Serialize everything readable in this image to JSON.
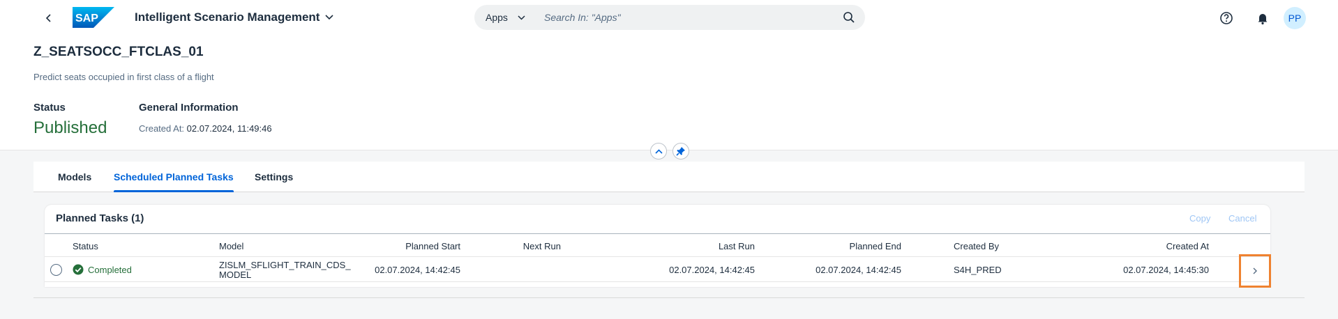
{
  "shell": {
    "logo_text": "SAP",
    "app_title": "Intelligent Scenario Management",
    "search_scope": "Apps",
    "search_placeholder": "Search In: \"Apps\"",
    "avatar_initials": "PP"
  },
  "header": {
    "title": "Z_SEATSOCC_FTCLAS_01",
    "subtitle": "Predict seats occupied in first class of a flight",
    "status_label": "Status",
    "status_value": "Published",
    "general_info_label": "General Information",
    "created_at_label": "Created At:",
    "created_at_value": "02.07.2024, 11:49:46"
  },
  "tabs": [
    {
      "label": "Models",
      "active": false
    },
    {
      "label": "Scheduled Planned Tasks",
      "active": true
    },
    {
      "label": "Settings",
      "active": false
    }
  ],
  "table": {
    "title": "Planned Tasks (1)",
    "actions": {
      "copy": "Copy",
      "cancel": "Cancel"
    },
    "columns": {
      "status": "Status",
      "model": "Model",
      "planned_start": "Planned Start",
      "next_run": "Next Run",
      "last_run": "Last Run",
      "planned_end": "Planned End",
      "created_by": "Created By",
      "created_at": "Created At"
    },
    "rows": [
      {
        "status": "Completed",
        "model_line1": "ZISLM_SFLIGHT_TRAIN_CDS_",
        "model_line2": "MODEL",
        "planned_start": "02.07.2024, 14:42:45",
        "next_run": "",
        "last_run": "02.07.2024, 14:42:45",
        "planned_end": "02.07.2024, 14:42:45",
        "created_by": "S4H_PRED",
        "created_at": "02.07.2024, 14:45:30"
      }
    ]
  },
  "colors": {
    "accent": "#0064d9",
    "success": "#256f3a",
    "highlight": "#ef8230",
    "logo": "#0a6ed1"
  }
}
